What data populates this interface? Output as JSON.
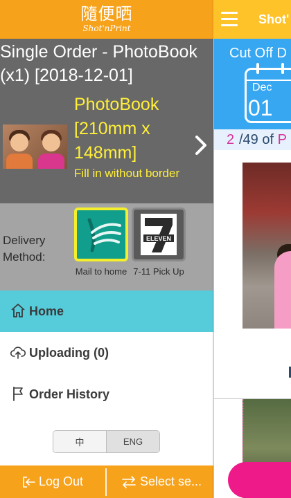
{
  "app": {
    "brand_cjk": "隨便晒",
    "brand_sub": "Shot'nPrint"
  },
  "order": {
    "title": "Single Order - PhotoBook (x1) [2018-12-01]",
    "product_name": "PhotoBook [210mm x 148mm]",
    "product_option": "Fill in without border"
  },
  "delivery": {
    "label": "Delivery Method:",
    "options": [
      {
        "label": "Mail to home",
        "selected": true,
        "icon": "mail-bird-icon"
      },
      {
        "label": "7-11 Pick Up",
        "selected": false,
        "icon": "seven-eleven-logo"
      }
    ],
    "store_logo_text": "ELEVEN"
  },
  "nav": {
    "items": [
      {
        "label": "Home",
        "icon": "home-icon",
        "active": true
      },
      {
        "label": "Uploading (0)",
        "icon": "cloud-upload-icon",
        "active": false
      },
      {
        "label": "Order History",
        "icon": "flag-icon",
        "active": false
      }
    ]
  },
  "language": {
    "options": [
      "中",
      "ENG"
    ],
    "selected": "ENG"
  },
  "footer": {
    "logout_label": "Log Out",
    "select_label": "Select se..."
  },
  "main": {
    "title": "Shot'",
    "cutoff_label": "Cut Off D",
    "calendar_month": "Dec",
    "calendar_day": "01",
    "progress_current": "2",
    "progress_rest": "/49 of",
    "progress_suffix": "P"
  },
  "colors": {
    "brand_orange": "#f7a21b",
    "header_yellow": "#ffc32a",
    "active_cyan": "#56ccdb",
    "highlight_yellow": "#ffef3a",
    "cutoff_blue": "#37a7f2",
    "accent_pink": "#ee1a8a"
  }
}
